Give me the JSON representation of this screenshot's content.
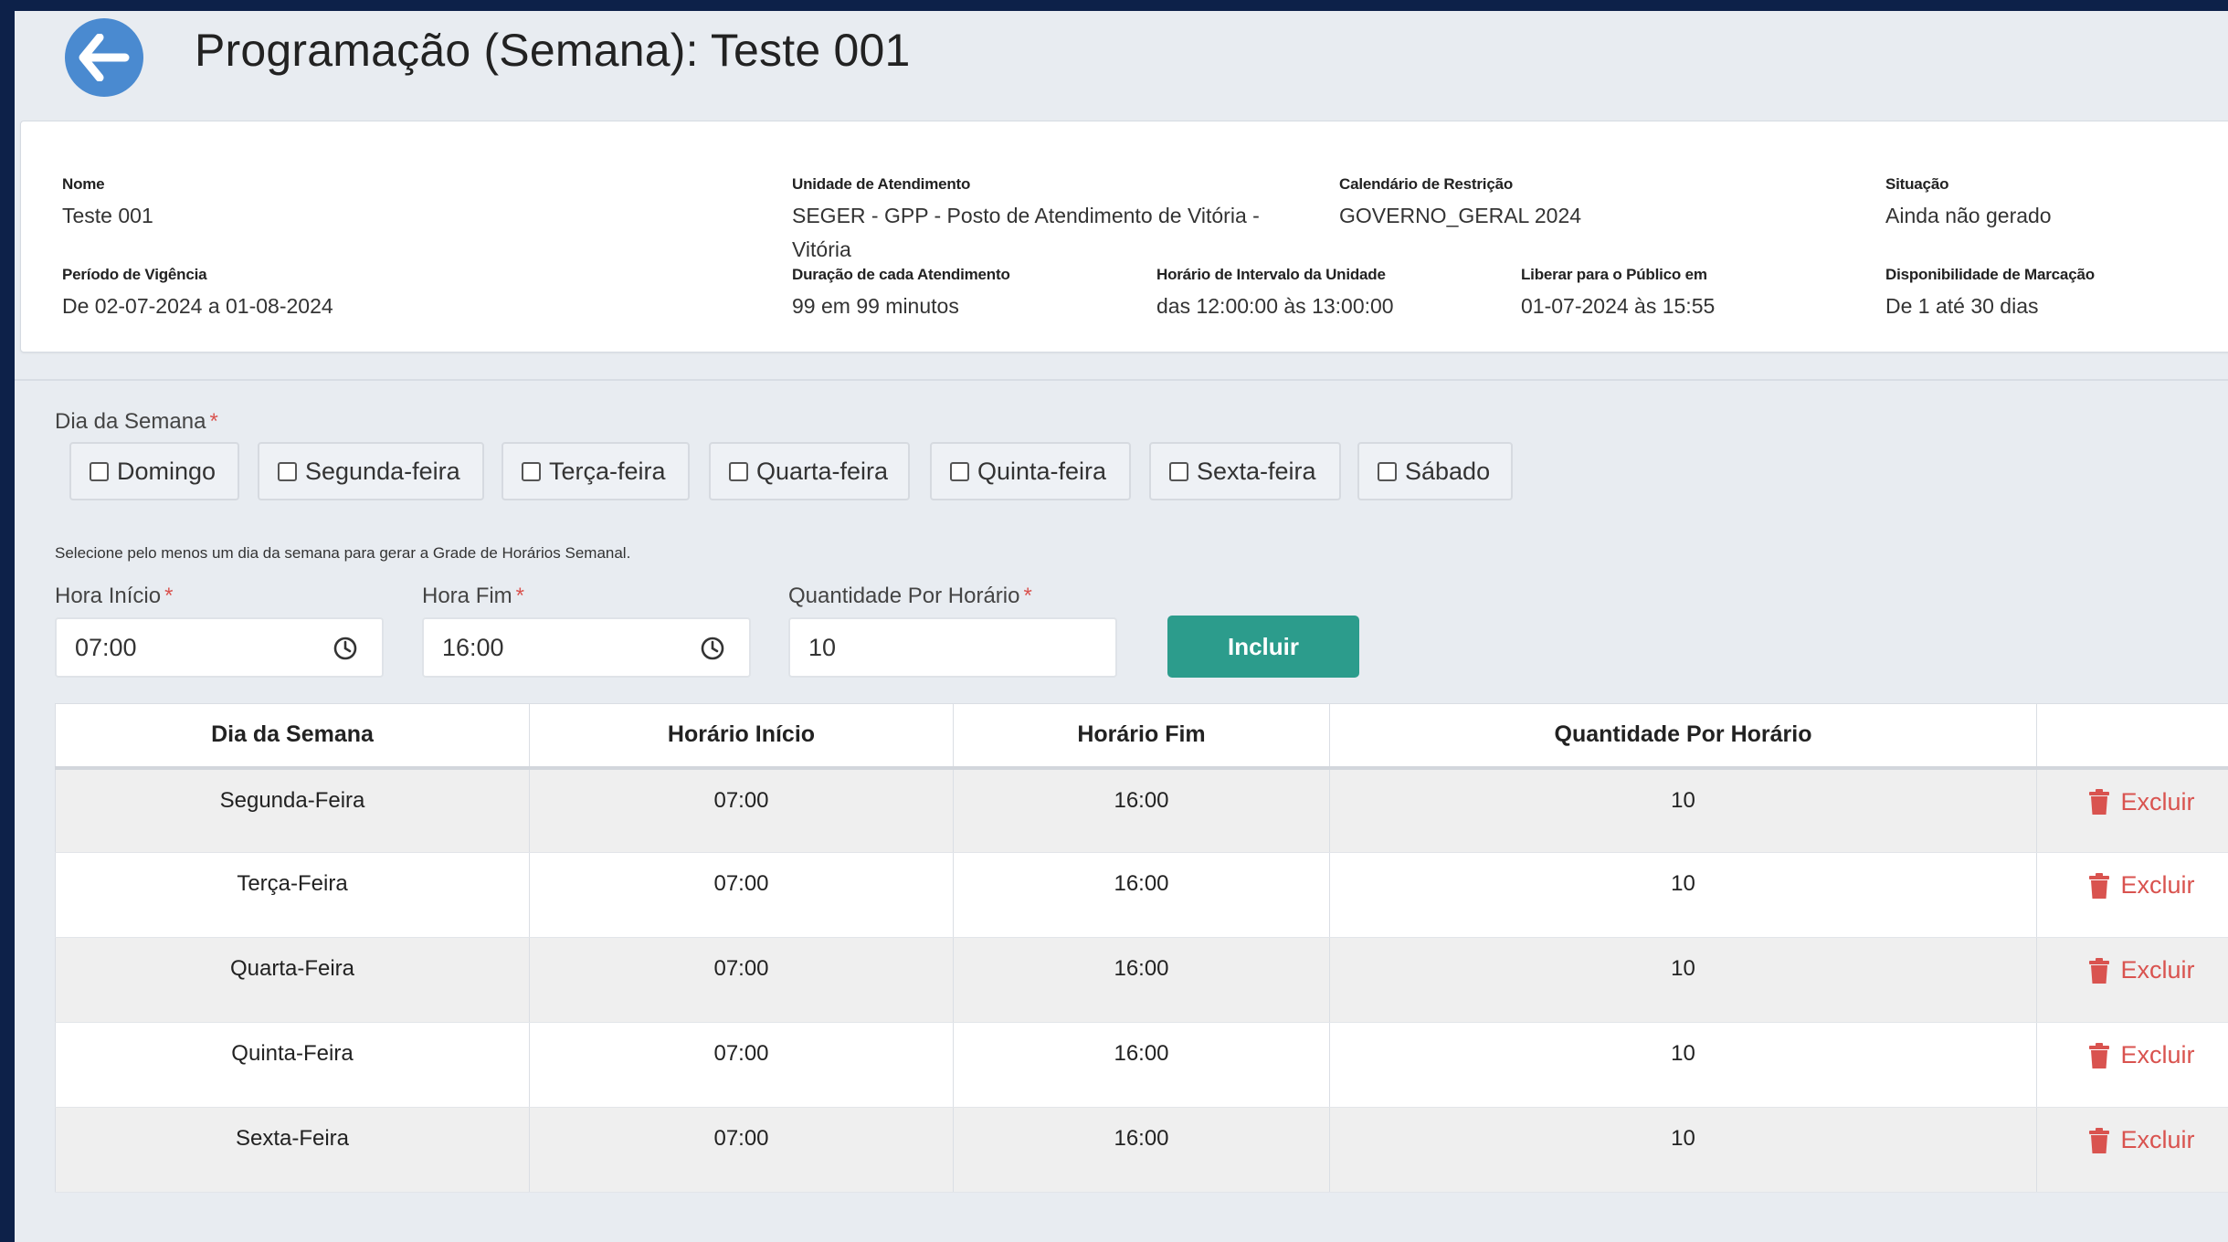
{
  "header": {
    "title": "Programação (Semana): Teste 001"
  },
  "info": {
    "nome": {
      "label": "Nome",
      "value": "Teste 001"
    },
    "unidade": {
      "label": "Unidade de Atendimento",
      "value_line1": "SEGER - GPP - Posto de Atendimento de Vitória -",
      "value_line2": "Vitória"
    },
    "calendario": {
      "label": "Calendário de Restrição",
      "value": "GOVERNO_GERAL 2024"
    },
    "situacao": {
      "label": "Situação",
      "value": "Ainda não gerado"
    },
    "periodo": {
      "label": "Período de Vigência",
      "value": "De 02-07-2024 a 01-08-2024"
    },
    "duracao": {
      "label": "Duração de cada Atendimento",
      "value": "99 em 99 minutos"
    },
    "intervalo": {
      "label": "Horário de Intervalo da Unidade",
      "value": "das 12:00:00 às 13:00:00"
    },
    "liberar": {
      "label": "Liberar para o Público em",
      "value": "01-07-2024 às 15:55"
    },
    "disponibilidade": {
      "label": "Disponibilidade de Marcação",
      "value": "De 1 até 30 dias"
    }
  },
  "form": {
    "dia_semana_label": "Dia da Semana",
    "required_mark": "*",
    "days": [
      "Domingo",
      "Segunda-feira",
      "Terça-feira",
      "Quarta-feira",
      "Quinta-feira",
      "Sexta-feira",
      "Sábado"
    ],
    "hint": "Selecione pelo menos um dia da semana para gerar a Grade de Horários Semanal.",
    "hora_inicio": {
      "label": "Hora Início",
      "value": "07:00"
    },
    "hora_fim": {
      "label": "Hora Fim",
      "value": "16:00"
    },
    "quantidade": {
      "label": "Quantidade Por Horário",
      "value": "10"
    },
    "add_button": "Incluir"
  },
  "table": {
    "headers": [
      "Dia da Semana",
      "Horário Início",
      "Horário Fim",
      "Quantidade Por Horário",
      ""
    ],
    "delete_label": "Excluir",
    "rows": [
      {
        "dia": "Segunda-Feira",
        "inicio": "07:00",
        "fim": "16:00",
        "qtd": "10"
      },
      {
        "dia": "Terça-Feira",
        "inicio": "07:00",
        "fim": "16:00",
        "qtd": "10"
      },
      {
        "dia": "Quarta-Feira",
        "inicio": "07:00",
        "fim": "16:00",
        "qtd": "10"
      },
      {
        "dia": "Quinta-Feira",
        "inicio": "07:00",
        "fim": "16:00",
        "qtd": "10"
      },
      {
        "dia": "Sexta-Feira",
        "inicio": "07:00",
        "fim": "16:00",
        "qtd": "10"
      }
    ]
  },
  "colors": {
    "accent": "#4a8ad0",
    "button": "#2c9c8c",
    "danger": "#d9534f",
    "frame": "#0d2149"
  },
  "icons": {
    "back": "arrow-left-icon",
    "clock": "clock-icon",
    "trash": "trash-icon",
    "checkbox": "checkbox-unchecked-icon"
  }
}
